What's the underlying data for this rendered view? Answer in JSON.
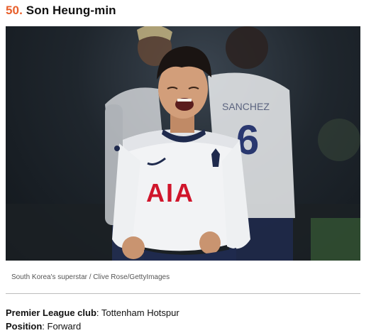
{
  "article": {
    "rank": "50.",
    "player_name": "Son Heung-min",
    "caption": "South Korea's superstar / Clive Rose/GettyImages",
    "details": [
      {
        "label": "Premier League club",
        "value": ": Tottenham Hotspur"
      },
      {
        "label": "Position",
        "value": ": Forward"
      }
    ]
  },
  "photo": {
    "shirt_sponsor": "AIA",
    "teammate_shirt_number": "6",
    "teammate_shirt_name": "SANCHEZ"
  },
  "colors": {
    "accent": "#e8602c",
    "sponsor_red": "#d0152b",
    "kit_navy": "#1f2a4d"
  }
}
